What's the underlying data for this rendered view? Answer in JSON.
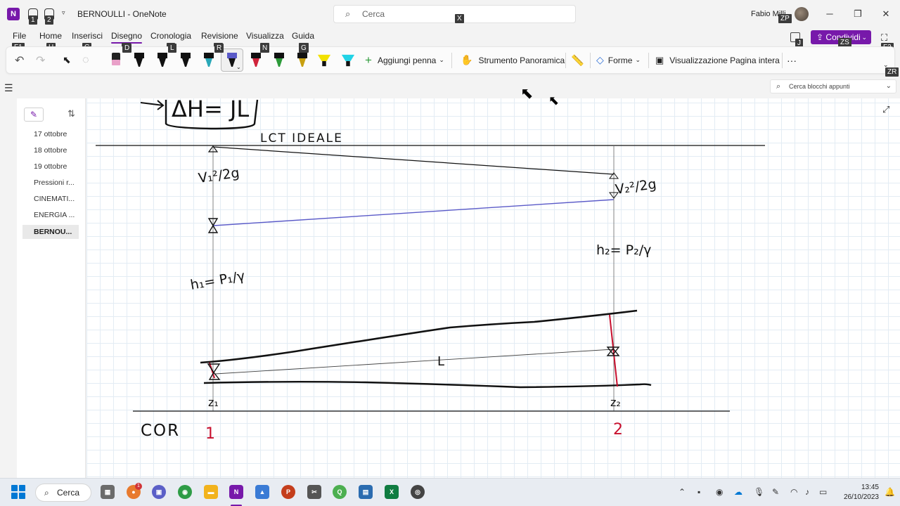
{
  "window": {
    "doc_title": "BERNOULLI  -  OneNote",
    "search_placeholder": "Cerca",
    "user_name": "Fabio Milli",
    "keytips": {
      "qa1": "1",
      "qa2": "2",
      "search": "X",
      "user": "ZP",
      "share": "ZS",
      "teams": "J",
      "fullscreen": "F2",
      "ribbon_collapse": "ZR"
    }
  },
  "menu": {
    "tabs": [
      {
        "label": "File",
        "keytip": "F1"
      },
      {
        "label": "Home",
        "keytip": "H"
      },
      {
        "label": "Inserisci",
        "keytip": "C"
      },
      {
        "label": "Disegno",
        "keytip": "D"
      },
      {
        "label": "Cronologia",
        "keytip": "L"
      },
      {
        "label": "Revisione",
        "keytip": "R"
      },
      {
        "label": "Visualizza",
        "keytip": "N"
      },
      {
        "label": "Guida",
        "keytip": "G"
      }
    ],
    "share_label": "Condividi"
  },
  "ribbon": {
    "add_pen": "Aggiungi penna",
    "pan_tool": "Strumento Panoramica",
    "shapes": "Forme",
    "full_page": "Visualizzazione Pagina intera",
    "more": "···"
  },
  "notebook": {
    "search_placeholder": "Cerca blocchi appunti"
  },
  "pages": [
    {
      "label": "17 ottobre"
    },
    {
      "label": "18 ottobre"
    },
    {
      "label": "19 ottobre"
    },
    {
      "label": "Pressioni r..."
    },
    {
      "label": "CINEMATI..."
    },
    {
      "label": "ENERGIA ..."
    },
    {
      "label": "BERNOU..."
    }
  ],
  "ink": {
    "top_formula": "ΔH= JL",
    "lct_label": "LCT IDEALE",
    "v1": "V₁²/2g",
    "v2": "V₂²/2g",
    "h1": "h₁= P₁/γ",
    "h2": "h₂= P₂/γ",
    "length": "L",
    "z1": "z₁",
    "z2": "z₂",
    "datum": "COR",
    "section1": "1",
    "section2": "2"
  },
  "taskbar": {
    "search": "Cerca",
    "time": "13:45",
    "date": "26/10/2023"
  },
  "colors": {
    "accent": "#7719aa",
    "ink_black": "#111111",
    "ink_blue": "#5a5ac8",
    "ink_red": "#c8102e"
  }
}
